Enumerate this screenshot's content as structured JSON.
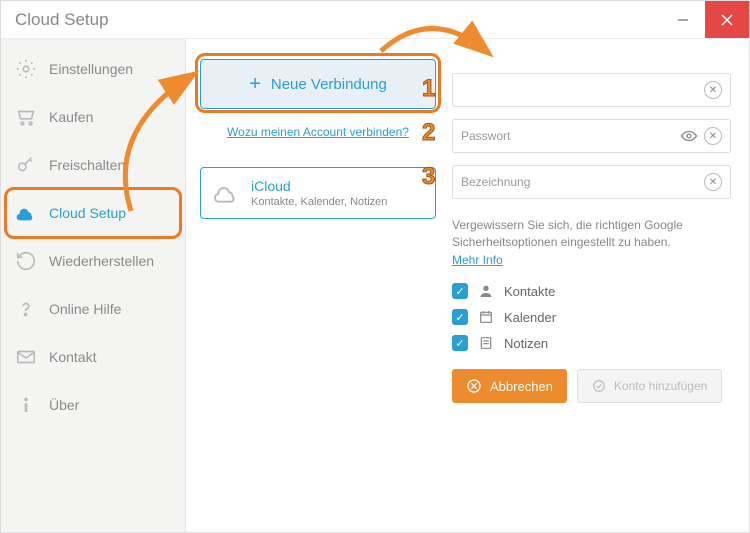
{
  "window": {
    "title": "Cloud Setup"
  },
  "sidebar": {
    "items": [
      {
        "label": "Einstellungen"
      },
      {
        "label": "Kaufen"
      },
      {
        "label": "Freischalten"
      },
      {
        "label": "Cloud Setup"
      },
      {
        "label": "Wiederherstellen"
      },
      {
        "label": "Online Hilfe"
      },
      {
        "label": "Kontakt"
      },
      {
        "label": "Über"
      }
    ]
  },
  "main": {
    "new_connection_label": "Neue Verbindung",
    "why_link": "Wozu meinen Account verbinden?",
    "cloud_card": {
      "title": "iCloud",
      "subtitle": "Kontakte, Kalender, Notizen"
    }
  },
  "form": {
    "field_email_value": "",
    "field_password_placeholder": "Passwort",
    "field_label_placeholder": "Bezeichnung",
    "hint_text": "Vergewissern Sie sich, die richtigen Google Sicherheitsoptionen eingestellt zu haben.",
    "hint_link": "Mehr Info",
    "checks": [
      {
        "label": "Kontakte"
      },
      {
        "label": "Kalender"
      },
      {
        "label": "Notizen"
      }
    ],
    "btn_cancel": "Abbrechen",
    "btn_add": "Konto hinzufügen"
  },
  "annotations": {
    "n1": "1",
    "n2": "2",
    "n3": "3"
  }
}
